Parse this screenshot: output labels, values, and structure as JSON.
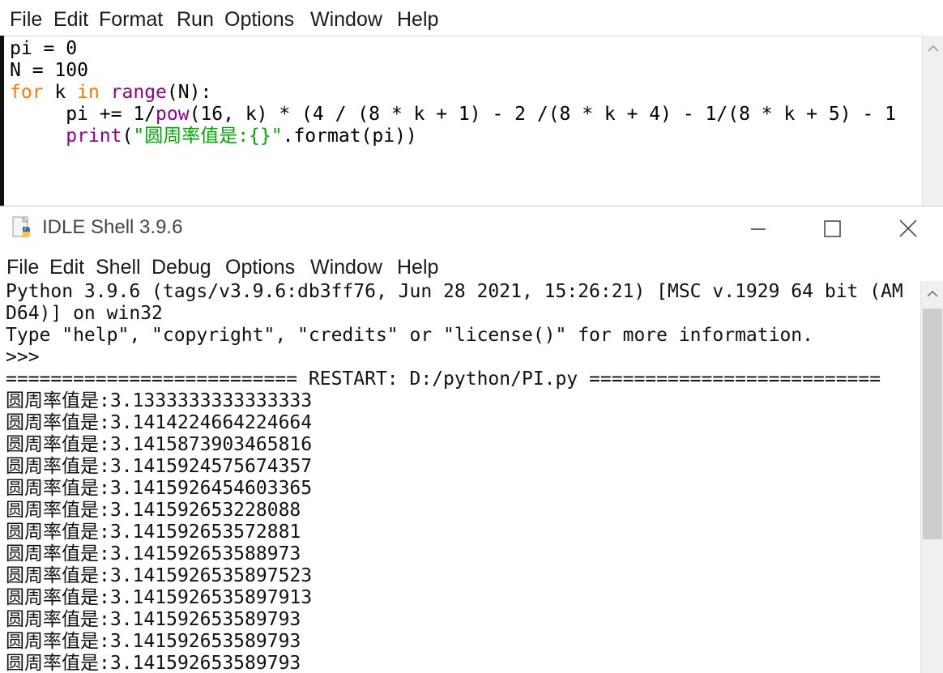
{
  "editor": {
    "menu": [
      "File",
      "Edit",
      "Format",
      "Run",
      "Options",
      "Window",
      "Help"
    ],
    "code": {
      "line1": "pi = 0",
      "line2": "N = 100",
      "line3": {
        "kw_for": "for",
        "mid1": " k ",
        "kw_in": "in",
        "mid2": " ",
        "bi_range": "range",
        "rest": "(N):"
      },
      "line4": {
        "indent": "     ",
        "pre": "pi += 1/",
        "bi_pow": "pow",
        "rest": "(16, k) * (4 / (8 * k + 1) - 2 /(8 * k + 4) - 1/(8 * k + 5) - 1"
      },
      "line5": {
        "indent": "     ",
        "bi_print": "print",
        "open": "(",
        "str": "\"圆周率值是:{}\"",
        "rest": ".format(pi))"
      }
    }
  },
  "shell": {
    "title": "IDLE Shell 3.9.6",
    "menu": [
      "File",
      "Edit",
      "Shell",
      "Debug",
      "Options",
      "Window",
      "Help"
    ],
    "banner": [
      "Python 3.9.6 (tags/v3.9.6:db3ff76, Jun 28 2021, 15:26:21) [MSC v.1929 64 bit (AM",
      "D64)] on win32",
      "Type \"help\", \"copyright\", \"credits\" or \"license()\" for more information."
    ],
    "prompt": ">>>",
    "restart": "========================== RESTART: D:/python/PI.py ==========================",
    "output_label": "圆周率值是:",
    "outputs": [
      "3.1333333333333333",
      "3.1414224664224664",
      "3.1415873903465816",
      "3.1415924575674357",
      "3.1415926454603365",
      "3.141592653228088",
      "3.141592653572881",
      "3.141592653588973",
      "3.1415926535897523",
      "3.1415926535897913",
      "3.141592653589793",
      "3.141592653589793",
      "3.141592653589793"
    ]
  },
  "colors": {
    "keyword": "#ff7700",
    "builtin": "#900090",
    "string": "#00aa00",
    "prompt": "#c00000",
    "stdout": "#1b1bd6"
  },
  "icons": {
    "app": "python-idle-icon",
    "minimize": "minimize-icon",
    "maximize": "maximize-icon",
    "close": "close-icon",
    "scroll_up": "chevron-up-icon",
    "scroll_down": "chevron-down-icon"
  }
}
